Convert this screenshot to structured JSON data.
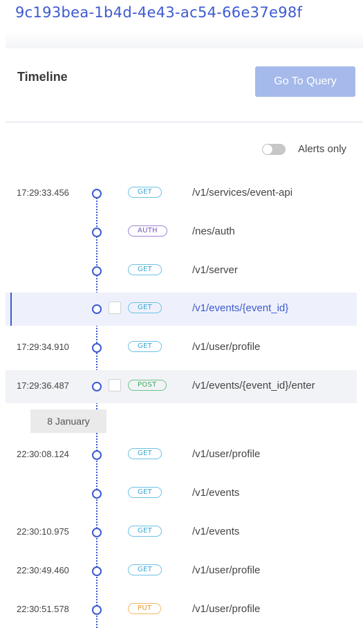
{
  "session_id": "9c193bea-1b4d-4e43-ac54-66e37e98f",
  "timeline": {
    "title": "Timeline",
    "goto_label": "Go To Query",
    "alerts_label": "Alerts only",
    "alerts_on": false
  },
  "date_separator": "8 January",
  "events": [
    {
      "time": "17:29:33.456",
      "method": "GET",
      "path": "/v1/services/event-api"
    },
    {
      "time": "",
      "method": "AUTH",
      "path": "/nes/auth"
    },
    {
      "time": "",
      "method": "GET",
      "path": "/v1/server"
    },
    {
      "time": "",
      "method": "GET",
      "path": "/v1/events/{event_id}"
    },
    {
      "time": "17:29:34.910",
      "method": "GET",
      "path": "/v1/user/profile"
    },
    {
      "time": "17:29:36.487",
      "method": "POST",
      "path": "/v1/events/{event_id}/enter"
    },
    {
      "time": "22:30:08.124",
      "method": "GET",
      "path": "/v1/user/profile"
    },
    {
      "time": "",
      "method": "GET",
      "path": "/v1/events"
    },
    {
      "time": "22:30:10.975",
      "method": "GET",
      "path": "/v1/events"
    },
    {
      "time": "22:30:49.460",
      "method": "GET",
      "path": "/v1/user/profile"
    },
    {
      "time": "22:30:51.578",
      "method": "PUT",
      "path": "/v1/user/profile"
    }
  ],
  "colors": {
    "accent": "#3d5ad1",
    "button": "#a5b9ea",
    "get": "#3aa6d6",
    "auth": "#7b53c2",
    "post": "#3ea85a",
    "put": "#e49a2c"
  }
}
